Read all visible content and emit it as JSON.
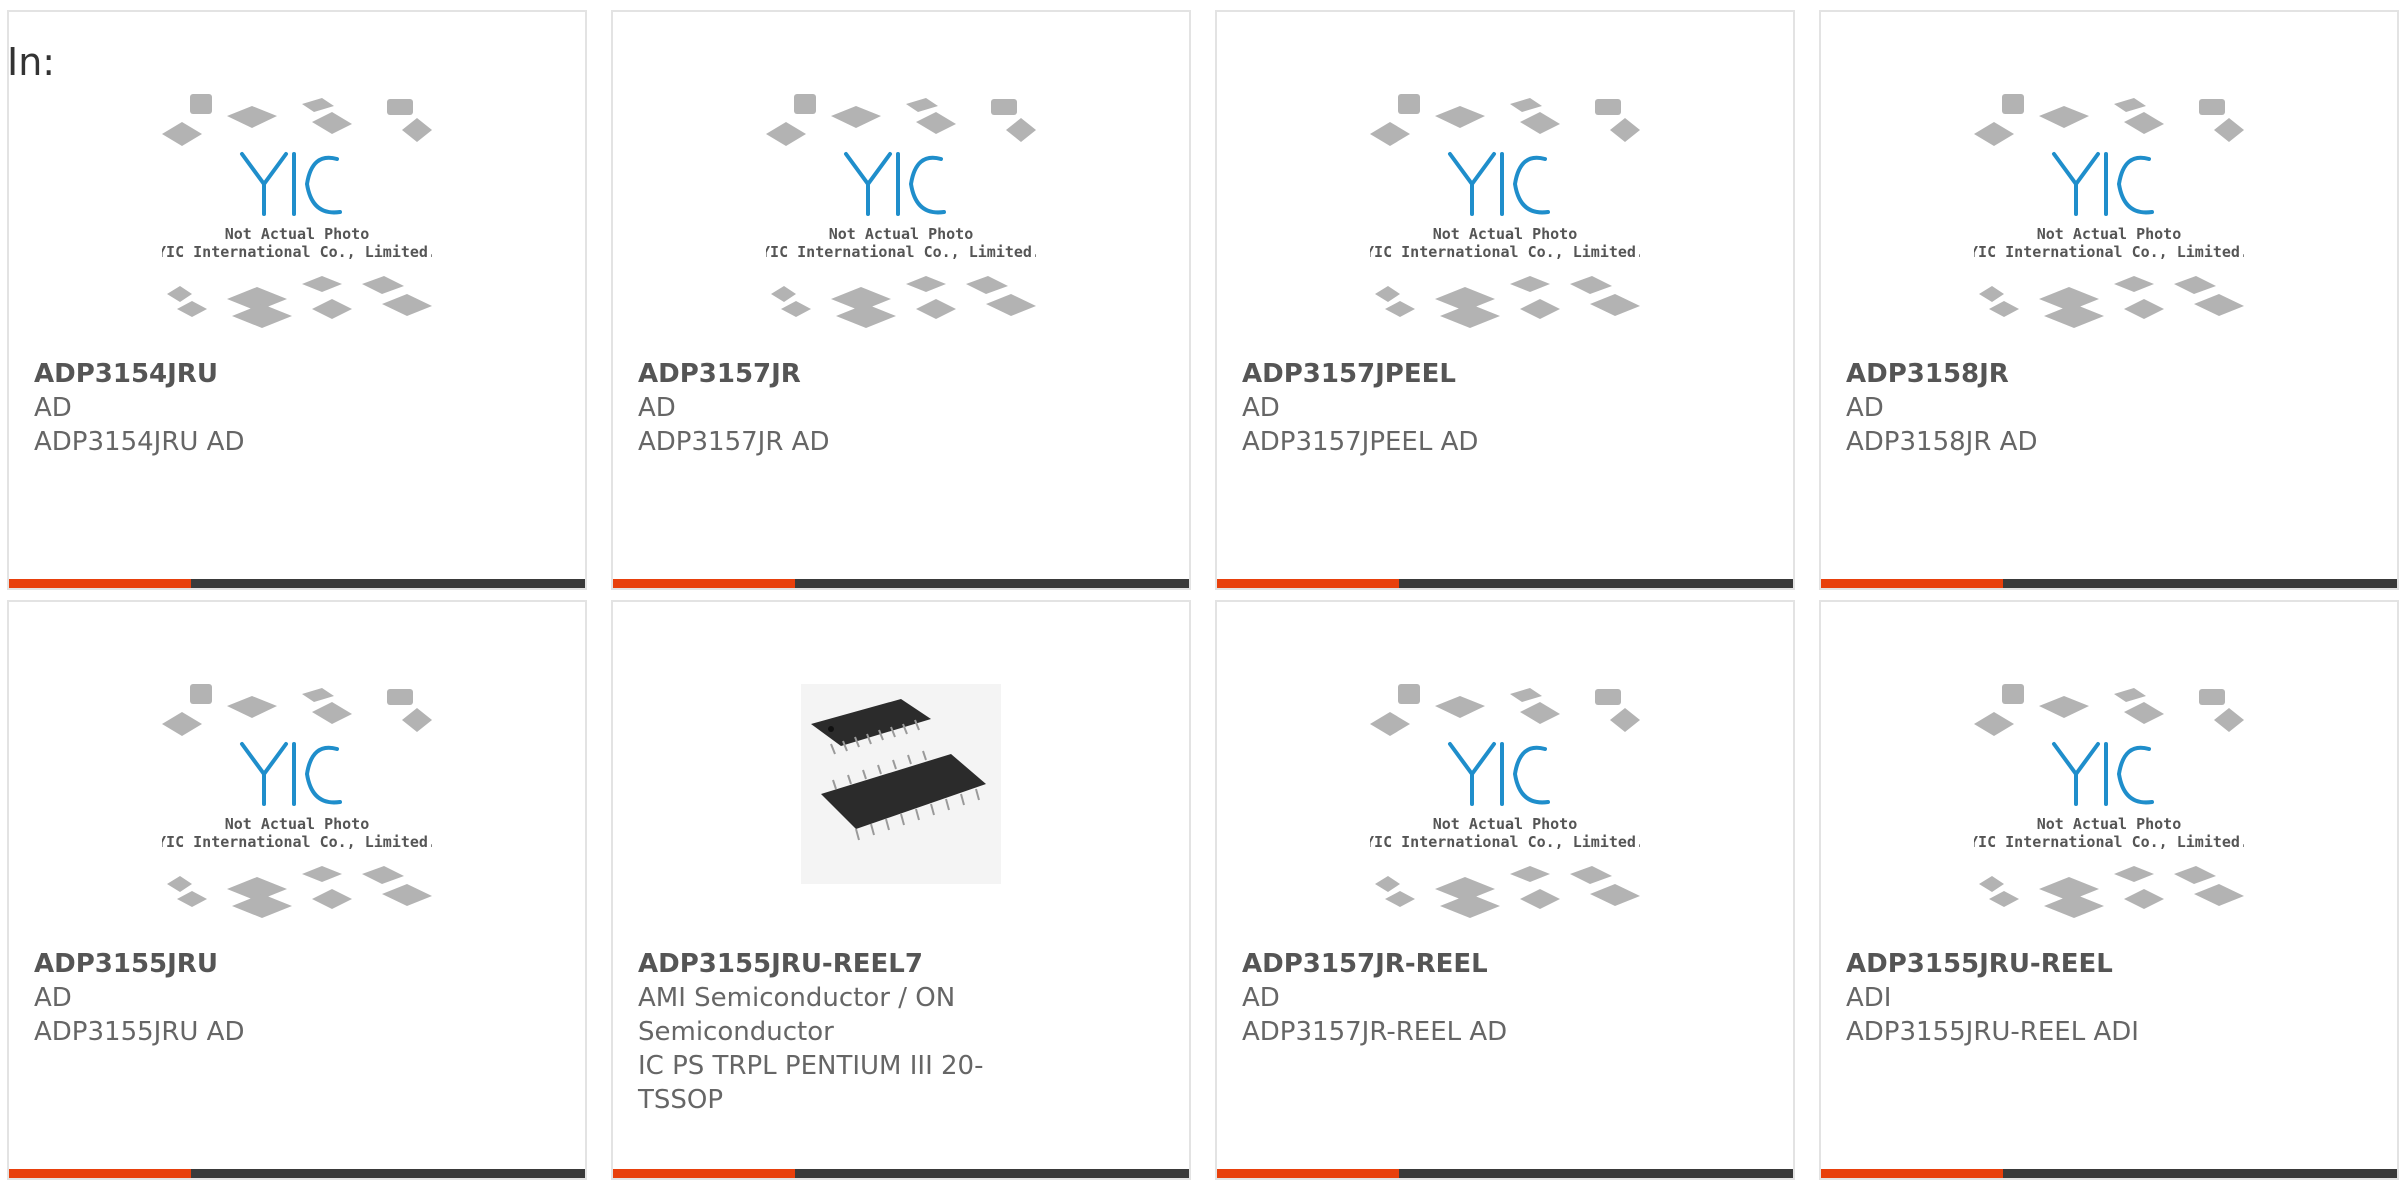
{
  "header": {
    "prefix_label": "In:"
  },
  "placeholder_photo": {
    "brand": "YIC",
    "caption_line1": "Not Actual Photo",
    "caption_line2": "YIC International Co., Limited."
  },
  "colors": {
    "accent": "#e8400c",
    "bar": "#3a3a3a",
    "logo": "#1f8ecb"
  },
  "products": [
    {
      "part": "ADP3154JRU",
      "maker": "AD",
      "desc": "ADP3154JRU AD",
      "image": "placeholder-photo"
    },
    {
      "part": "ADP3157JR",
      "maker": "AD",
      "desc": "ADP3157JR AD",
      "image": "placeholder-photo"
    },
    {
      "part": "ADP3157JPEEL",
      "maker": "AD",
      "desc": "ADP3157JPEEL AD",
      "image": "placeholder-photo"
    },
    {
      "part": "ADP3158JR",
      "maker": "AD",
      "desc": "ADP3158JR AD",
      "image": "placeholder-photo"
    },
    {
      "part": "ADP3155JRU",
      "maker": "AD",
      "desc": "ADP3155JRU AD",
      "image": "placeholder-photo"
    },
    {
      "part": "ADP3155JRU-REEL7",
      "maker": "AMI Semiconductor / ON Semiconductor",
      "desc": "IC PS TRPL PENTIUM III 20-TSSOP",
      "image": "tssop-chip-photo"
    },
    {
      "part": "ADP3157JR-REEL",
      "maker": "AD",
      "desc": "ADP3157JR-REEL AD",
      "image": "placeholder-photo"
    },
    {
      "part": "ADP3155JRU-REEL",
      "maker": "ADI",
      "desc": "ADP3155JRU-REEL ADI",
      "image": "placeholder-photo"
    }
  ]
}
